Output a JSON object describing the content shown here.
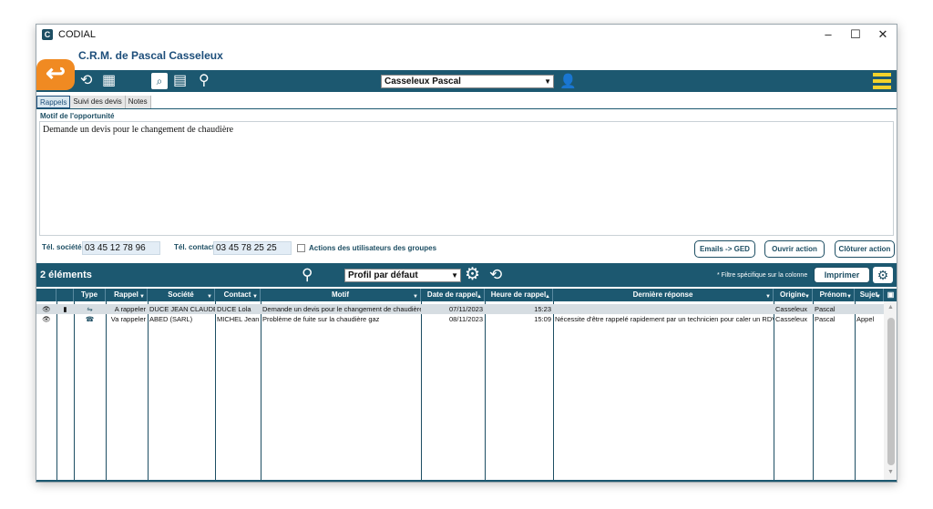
{
  "window": {
    "app_title": "CODIAL",
    "controls": [
      "–",
      "☐",
      "✕"
    ]
  },
  "header": {
    "title": "C.R.M. de Pascal Casseleux",
    "user_select": "Casseleux Pascal"
  },
  "tabs": [
    "Rappels",
    "Suivi des devis",
    "Notes"
  ],
  "form": {
    "motif_label": "Motif de l'opportunité",
    "motif_value": "Demande un devis pour le changement de chaudière",
    "tel_societe_label": "Tél. société",
    "tel_societe_value": "03 45 12 78 96",
    "tel_contact_label": "Tél. contact",
    "tel_contact_value": "03 45 78 25 25",
    "checkbox_label": "Actions des utilisateurs des groupes",
    "btn_emails": "Emails -> GED",
    "btn_ouvrir": "Ouvrir action",
    "btn_cloturer": "Clôturer action"
  },
  "list": {
    "count": "2 éléments",
    "profile": "Profil par défaut",
    "filter_note": "* Filtre spécifique sur la colonne",
    "print_label": "Imprimer",
    "columns": [
      "Type",
      "Rappel",
      "Société",
      "Contact",
      "Motif",
      "Date de rappel",
      "Heure de rappel",
      "Dernière réponse",
      "Origine",
      "Prénom",
      "Sujet"
    ],
    "rows": [
      {
        "rappel": "A rappeler",
        "societe": "DUCE JEAN CLAUDE",
        "contact": "DUCE Lola",
        "motif": "Demande un devis pour le changement de chaudière",
        "date": "07/11/2023",
        "heure": "15:23",
        "derniere": "",
        "origine": "Casseleux",
        "prenom": "Pascal",
        "sujet": ""
      },
      {
        "rappel": "Va rappeler",
        "societe": "ABED (SARL)",
        "contact": "MICHEL Jean",
        "motif": "Problème de fuite sur la chaudière gaz",
        "date": "08/11/2023",
        "heure": "15:09",
        "derniere": "Nécessite d'être rappelé rapidement par un technicien pour caler un RDV",
        "origine": "Casseleux",
        "prenom": "Pascal",
        "sujet": "Appel"
      }
    ]
  },
  "colors": {
    "primary": "#1c5870",
    "accent": "#f08a22",
    "menu": "#f3d22b"
  }
}
